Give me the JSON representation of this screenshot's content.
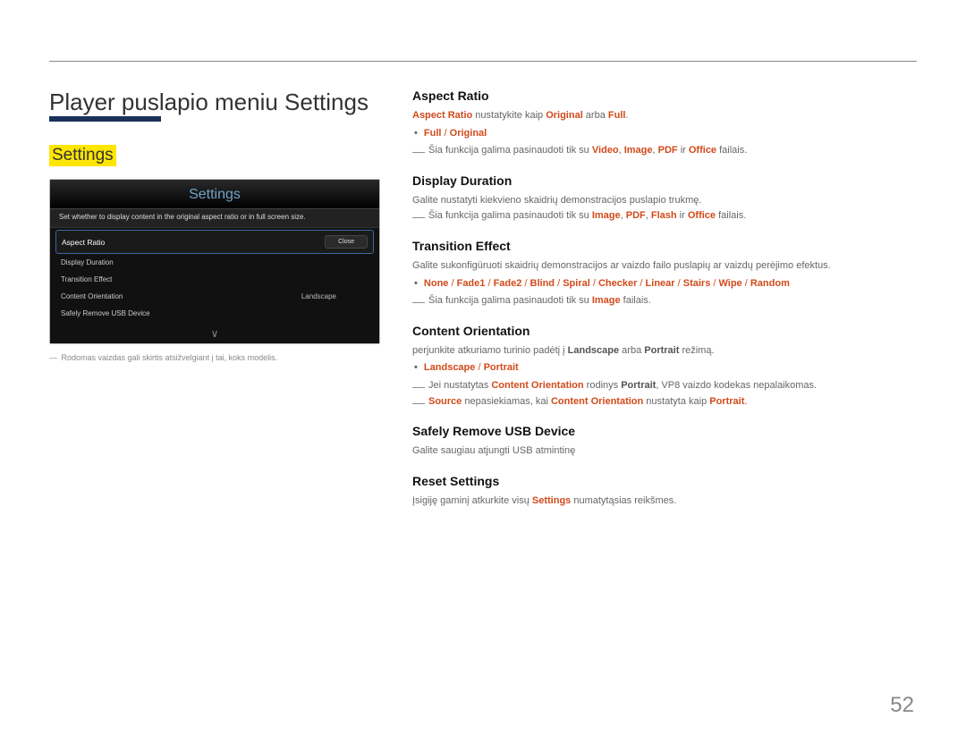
{
  "page": {
    "number": "52",
    "title": "Player puslapio meniu Settings",
    "settings_label": "Settings"
  },
  "device": {
    "title": "Settings",
    "desc": "Set whether to display content in the original aspect ratio or in full screen size.",
    "rows": {
      "aspect": "Aspect Ratio",
      "display": "Display Duration",
      "transition": "Transition Effect",
      "content": "Content Orientation",
      "content_val": "Landscape",
      "safely": "Safely Remove USB Device",
      "close": "Close",
      "more": "∨"
    }
  },
  "footnote": {
    "dash": "―",
    "text": "Rodomas vaizdas gali skirtis atsižvelgiant į tai, koks modelis."
  },
  "sections": {
    "aspect": {
      "h": "Aspect Ratio",
      "line1_pre": "Aspect Ratio",
      "line1_mid": " nustatykite kaip ",
      "line1_or": "Original",
      "line1_or_text": " arba ",
      "line1_full": "Full",
      "line1_end": ".",
      "bullets": {
        "full": "Full",
        "sep": " / ",
        "original": "Original"
      },
      "note_pre": "Šia funkcija galima pasinaudoti tik su ",
      "t1": "Video",
      "t2": "Image",
      "t3": "PDF",
      "t4": "Office",
      "note_mid": ", ",
      "note_ir": " ir ",
      "note_end": " failais."
    },
    "display": {
      "h": "Display Duration",
      "p": "Galite nustatyti kiekvieno skaidrių demonstracijos puslapio trukmę.",
      "note_pre": "Šia funkcija galima pasinaudoti tik su ",
      "t1": "Image",
      "t2": "PDF",
      "t3": "Flash",
      "t4": "Office",
      "note_mid": ", ",
      "note_ir": " ir ",
      "note_end": " failais."
    },
    "transition": {
      "h": "Transition Effect",
      "p": "Galite sukonfigūruoti skaidrių demonstracijos ar vaizdo failo puslapių ar vaizdų perėjimo efektus.",
      "opts": [
        "None",
        "Fade1",
        "Fade2",
        "Blind",
        "Spiral",
        "Checker",
        "Linear",
        "Stairs",
        "Wipe",
        "Random"
      ],
      "sep": " / ",
      "note_pre": "Šia funkcija galima pasinaudoti tik su ",
      "t1": "Image",
      "note_end": " failais."
    },
    "content": {
      "h": "Content Orientation",
      "p_pre": "perjunkite atkuriamo turinio padėtį į ",
      "v1": "Landscape",
      "p_or": " arba ",
      "v2": "Portrait",
      "p_end": " režimą.",
      "bullets": {
        "land": "Landscape",
        "sep": " / ",
        "port": "Portrait"
      },
      "note1_pre": "Jei nustatytas ",
      "note1_co": "Content Orientation",
      "note1_mid": " rodinys ",
      "note1_port": "Portrait",
      "note1_end": ", VP8 vaizdo kodekas nepalaikomas.",
      "note2_src": "Source",
      "note2_mid": " nepasiekiamas, kai ",
      "note2_co": "Content Orientation",
      "note2_set": " nustatyta kaip ",
      "note2_port": "Portrait",
      "note2_end": "."
    },
    "safely": {
      "h": "Safely Remove USB Device",
      "p": "Galite saugiau atjungti USB atmintinę"
    },
    "reset": {
      "h": "Reset Settings",
      "p_pre": "Įsigiję gaminį atkurkite visų ",
      "p_set": "Settings",
      "p_end": " numatytąsias reikšmes."
    }
  }
}
